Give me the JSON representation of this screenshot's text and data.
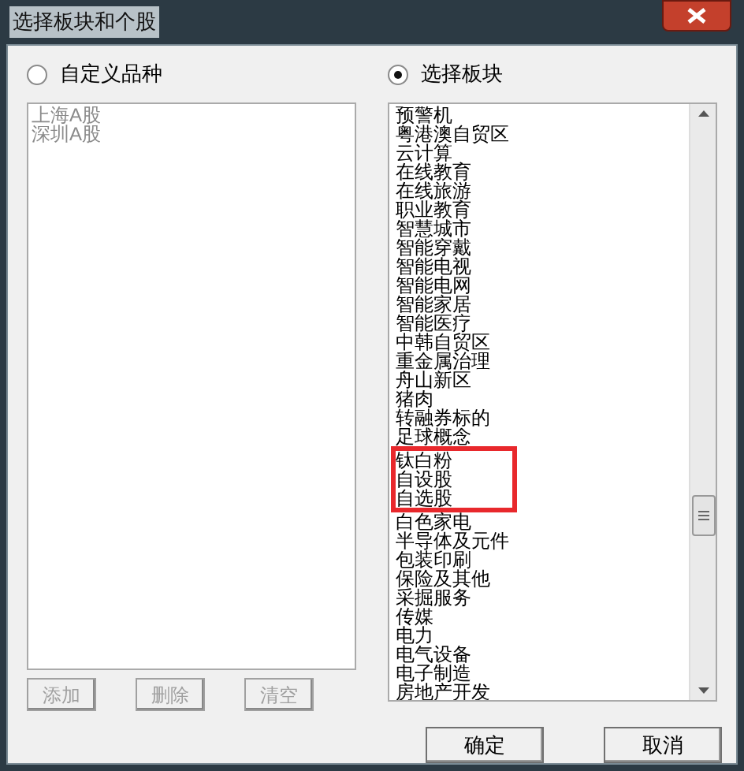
{
  "window": {
    "title": "选择板块和个股"
  },
  "modes": [
    {
      "label": "自定义品种",
      "selected": false
    },
    {
      "label": "选择板块",
      "selected": true
    }
  ],
  "custom_list": {
    "disabled": true,
    "items": [
      "上海A股",
      "深圳A股"
    ]
  },
  "custom_buttons": [
    {
      "label": "添加",
      "disabled": true
    },
    {
      "label": "删除",
      "disabled": true
    },
    {
      "label": "清空",
      "disabled": true
    }
  ],
  "sector_list": [
    {
      "label": "预警机",
      "highlighted": false
    },
    {
      "label": "粤港澳自贸区",
      "highlighted": false
    },
    {
      "label": "云计算",
      "highlighted": false
    },
    {
      "label": "在线教育",
      "highlighted": false
    },
    {
      "label": "在线旅游",
      "highlighted": false
    },
    {
      "label": "职业教育",
      "highlighted": false
    },
    {
      "label": "智慧城市",
      "highlighted": false
    },
    {
      "label": "智能穿戴",
      "highlighted": false
    },
    {
      "label": "智能电视",
      "highlighted": false
    },
    {
      "label": "智能电网",
      "highlighted": false
    },
    {
      "label": "智能家居",
      "highlighted": false
    },
    {
      "label": "智能医疗",
      "highlighted": false
    },
    {
      "label": "中韩自贸区",
      "highlighted": false
    },
    {
      "label": "重金属治理",
      "highlighted": false
    },
    {
      "label": "舟山新区",
      "highlighted": false
    },
    {
      "label": "猪肉",
      "highlighted": false
    },
    {
      "label": "转融券标的",
      "highlighted": false
    },
    {
      "label": "足球概念",
      "highlighted": false
    },
    {
      "label": "钛白粉",
      "highlighted": true
    },
    {
      "label": "自设股",
      "highlighted": true
    },
    {
      "label": "自选股",
      "highlighted": true
    },
    {
      "label": "白色家电",
      "highlighted": false
    },
    {
      "label": "半导体及元件",
      "highlighted": false
    },
    {
      "label": "包装印刷",
      "highlighted": false
    },
    {
      "label": "保险及其他",
      "highlighted": false
    },
    {
      "label": "采掘服务",
      "highlighted": false
    },
    {
      "label": "传媒",
      "highlighted": false
    },
    {
      "label": "电力",
      "highlighted": false
    },
    {
      "label": "电气设备",
      "highlighted": false
    },
    {
      "label": "电子制造",
      "highlighted": false
    },
    {
      "label": "房地产开发",
      "highlighted": false
    }
  ],
  "buttons": [
    "确定",
    "取消"
  ]
}
